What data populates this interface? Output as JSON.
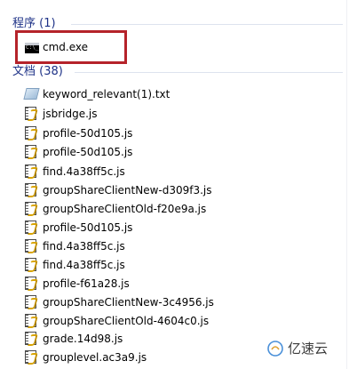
{
  "groups": [
    {
      "title": "程序 (1)",
      "items": [
        {
          "label": "cmd.exe",
          "icon": "cmd-icon"
        }
      ]
    },
    {
      "title": "文档 (38)",
      "items": [
        {
          "label": "keyword_relevant(1).txt",
          "icon": "text-file-icon"
        },
        {
          "label": "jsbridge.js",
          "icon": "js-file-icon"
        },
        {
          "label": "profile-50d105.js",
          "icon": "js-file-icon"
        },
        {
          "label": "profile-50d105.js",
          "icon": "js-file-icon"
        },
        {
          "label": "find.4a38ff5c.js",
          "icon": "js-file-icon"
        },
        {
          "label": "groupShareClientNew-d309f3.js",
          "icon": "js-file-icon"
        },
        {
          "label": "groupShareClientOld-f20e9a.js",
          "icon": "js-file-icon"
        },
        {
          "label": "profile-50d105.js",
          "icon": "js-file-icon"
        },
        {
          "label": "find.4a38ff5c.js",
          "icon": "js-file-icon"
        },
        {
          "label": "find.4a38ff5c.js",
          "icon": "js-file-icon"
        },
        {
          "label": "profile-f61a28.js",
          "icon": "js-file-icon"
        },
        {
          "label": "groupShareClientNew-3c4956.js",
          "icon": "js-file-icon"
        },
        {
          "label": "groupShareClientOld-4604c0.js",
          "icon": "js-file-icon"
        },
        {
          "label": "grade.14d98.js",
          "icon": "js-file-icon"
        },
        {
          "label": "grouplevel.ac3a9.js",
          "icon": "js-file-icon"
        }
      ]
    }
  ],
  "watermark": {
    "text": "亿速云"
  },
  "colors": {
    "header": "#1e3287",
    "highlight": "#b5232a"
  }
}
